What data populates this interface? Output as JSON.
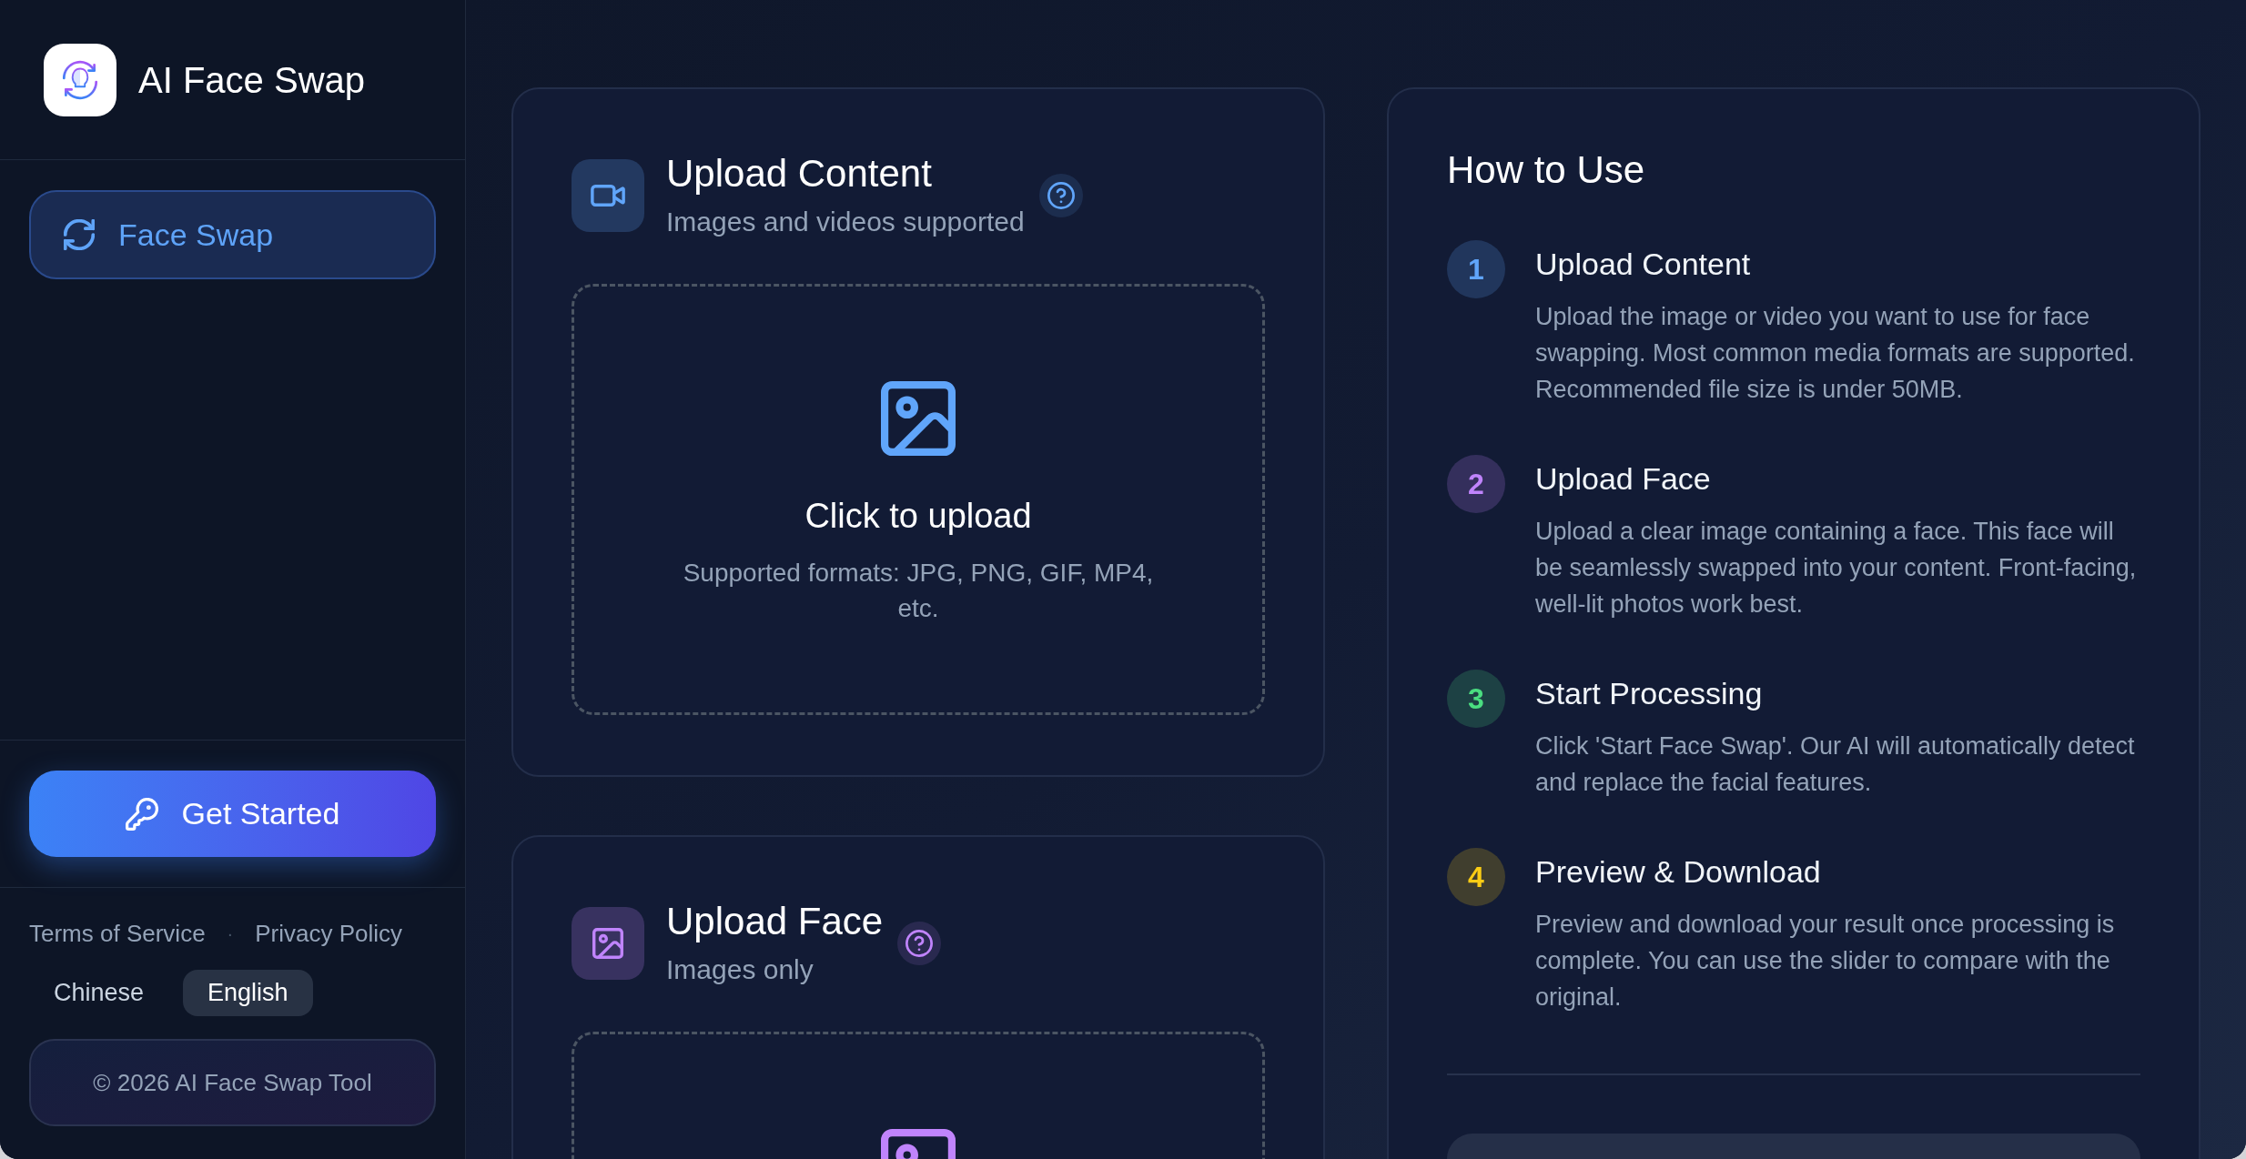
{
  "sidebar": {
    "app_title": "AI Face Swap",
    "nav_items": [
      {
        "label": "Face Swap",
        "selected": true
      }
    ],
    "cta_button": "Get Started",
    "footer_links": [
      "Terms of Service",
      "Privacy Policy"
    ],
    "link_separator": "·",
    "languages": [
      {
        "label": "Chinese",
        "selected": false
      },
      {
        "label": "English",
        "selected": true
      }
    ],
    "copyright": "© 2026 AI Face Swap Tool"
  },
  "upload_sections": [
    {
      "kind": "content",
      "color": "#60a5fa",
      "title": "Upload Content",
      "subtitle": "Images and videos supported",
      "dropzone": {
        "prompt": "Click to upload",
        "hint": "Supported formats: JPG, PNG, GIF, MP4, etc."
      }
    },
    {
      "kind": "face",
      "color": "#c084fc",
      "title": "Upload Face",
      "subtitle": "Images only"
    }
  ],
  "how_to_use": {
    "title": "How to Use",
    "steps": [
      {
        "number": "1",
        "color": "#60a5fa",
        "title": "Upload Content",
        "description": "Upload the image or video you want to use for face swapping. Most common media formats are supported. Recommended file size is under 50MB."
      },
      {
        "number": "2",
        "color": "#c084fc",
        "title": "Upload Face",
        "description": "Upload a clear image containing a face. This face will be seamlessly swapped into your content. Front-facing, well-lit photos work best."
      },
      {
        "number": "3",
        "color": "#4ade80",
        "title": "Start Processing",
        "description": "Click 'Start Face Swap'. Our AI will automatically detect and replace the facial features."
      },
      {
        "number": "4",
        "color": "#facc15",
        "title": "Preview & Download",
        "description": "Preview and download your result once processing is complete. You can use the slider to compare with the original."
      }
    ]
  }
}
